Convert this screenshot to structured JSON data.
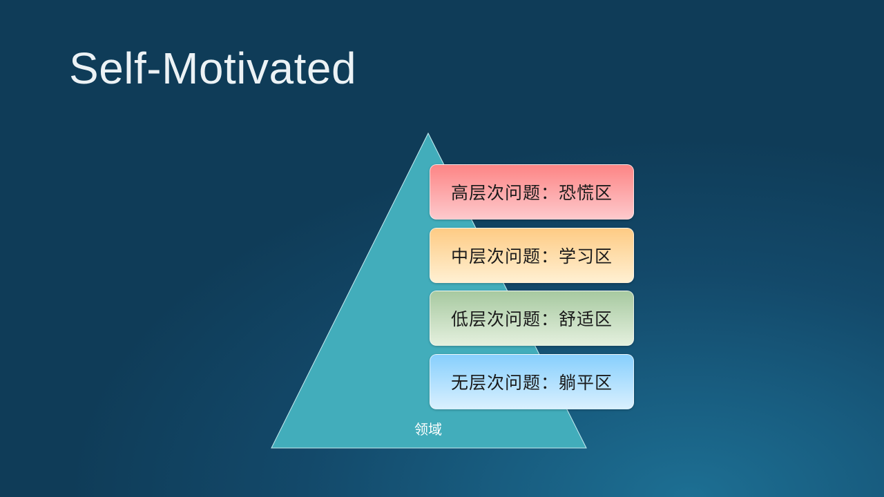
{
  "slide": {
    "title": "Self-Motivated"
  },
  "diagram": {
    "type": "pyramid",
    "base_label": "领域",
    "levels": [
      {
        "label": "高层次问题：恐慌区",
        "color": "#fd8585"
      },
      {
        "label": "中层次问题：学习区",
        "color": "#fecb84"
      },
      {
        "label": "低层次问题：舒适区",
        "color": "#a7c9a0"
      },
      {
        "label": "无层次问题：躺平区",
        "color": "#87cffd"
      }
    ],
    "pyramid_color": "#42adbb"
  }
}
